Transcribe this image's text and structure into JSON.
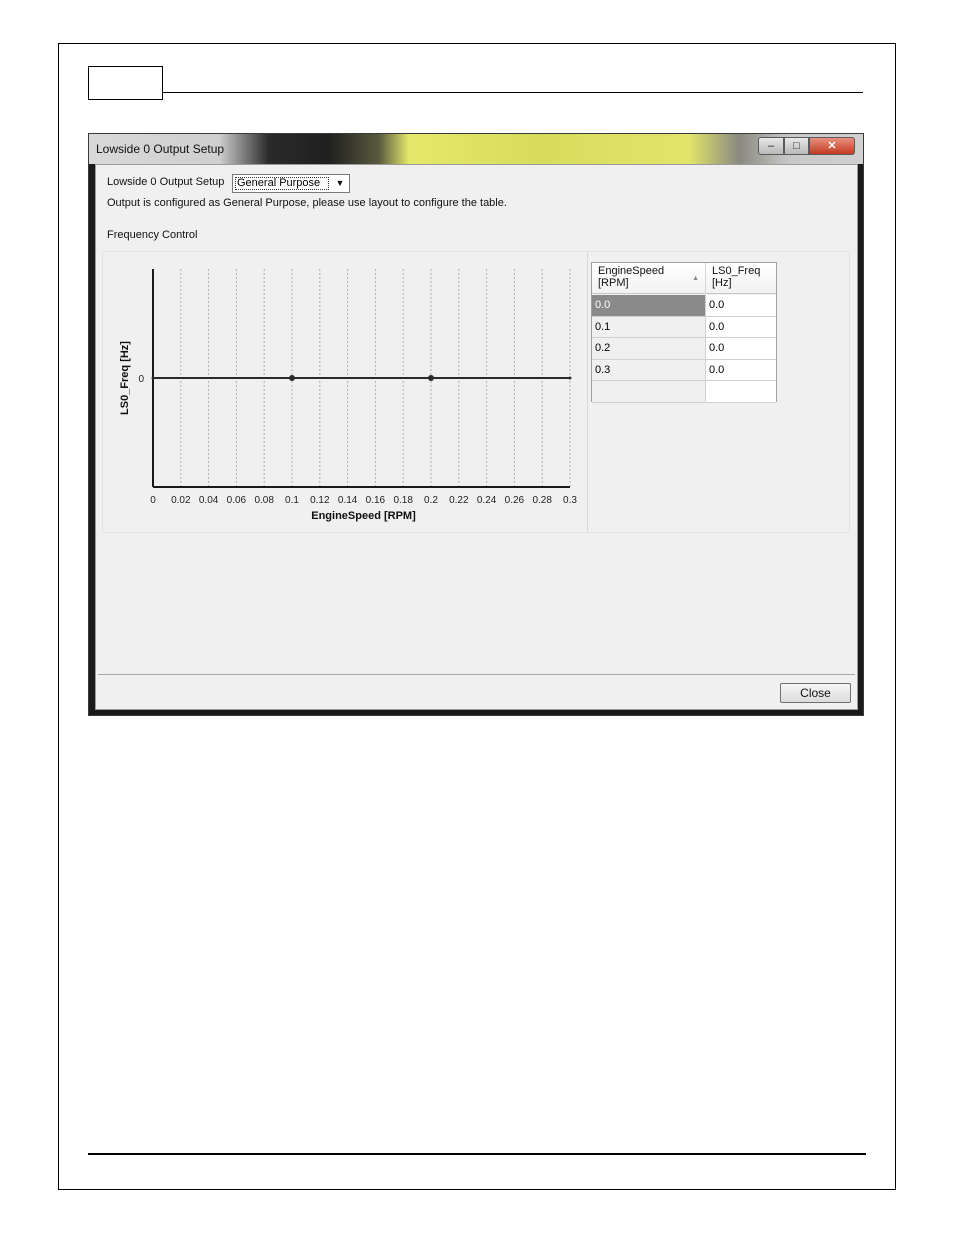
{
  "window": {
    "title": "Lowside 0 Output Setup",
    "controls": {
      "minimize": "–",
      "maximize": "□",
      "close": "✕"
    }
  },
  "form": {
    "setup_label": "Lowside 0 Output Setup",
    "setup_value": "General Purpose",
    "info_text": "Output is configured as General Purpose, please use layout to configure the table.",
    "group_label": "Frequency Control"
  },
  "table": {
    "columns": [
      {
        "line1": "EngineSpeed",
        "line2": "[RPM]"
      },
      {
        "line1": "LS0_Freq",
        "line2": "[Hz]"
      }
    ],
    "rows": [
      {
        "speed": "0.0",
        "freq": "0.0"
      },
      {
        "speed": "0.1",
        "freq": "0.0"
      },
      {
        "speed": "0.2",
        "freq": "0.0"
      },
      {
        "speed": "0.3",
        "freq": "0.0"
      },
      {
        "speed": "",
        "freq": ""
      }
    ],
    "selected_row": 0
  },
  "buttons": {
    "close": "Close"
  },
  "chart_data": {
    "type": "line",
    "xlabel": "EngineSpeed [RPM]",
    "ylabel": "LS0_Freq [Hz]",
    "xlim": [
      0,
      0.3
    ],
    "x_ticks": [
      "0",
      "0.02",
      "0.04",
      "0.06",
      "0.08",
      "0.1",
      "0.12",
      "0.14",
      "0.16",
      "0.18",
      "0.2",
      "0.22",
      "0.24",
      "0.26",
      "0.28",
      "0.3"
    ],
    "y_ticks": [
      "0"
    ],
    "grid": "vertical-dashed",
    "series": [
      {
        "x": [
          0.0,
          0.1,
          0.2,
          0.3
        ],
        "y": [
          0,
          0,
          0,
          0
        ]
      }
    ],
    "line_color": "#2b2b2b"
  }
}
